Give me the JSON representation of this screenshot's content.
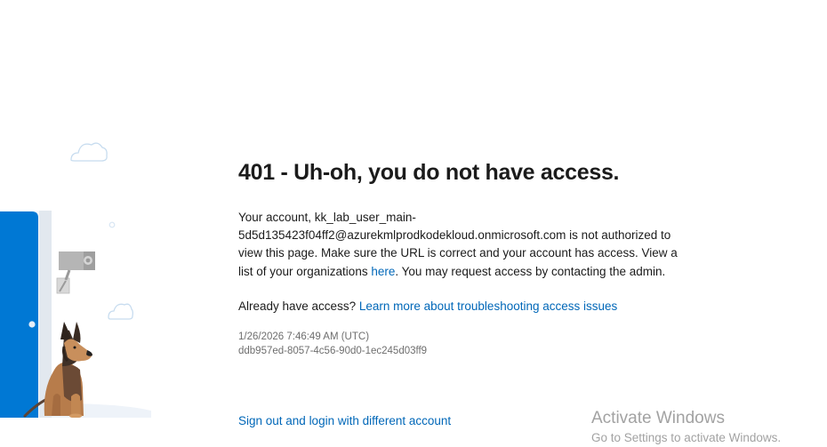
{
  "error": {
    "title": "401 - Uh-oh, you do not have access.",
    "message_part1": "Your account, kk_lab_user_main-5d5d135423f04ff2@azurekmlprodkodekloud.onmicrosoft.com is not authorized to view this page. Make sure the URL is correct and your account has access. View a list of your organizations ",
    "organizations_link": "here",
    "message_part2": ". You may request access by contacting the admin.",
    "already_have_access": "Already have access?",
    "troubleshoot_link": "Learn more about troubleshooting access issues",
    "timestamp": "1/26/2026 7:46:49 AM (UTC)",
    "correlation_id": "ddb957ed-8057-4c56-90d0-1ec245d03ff9",
    "signout_link": "Sign out and login with different account"
  },
  "watermark": {
    "title": "Activate Windows",
    "subtitle": "Go to Settings to activate Windows."
  },
  "colors": {
    "link": "#0067b8",
    "door": "#0078d4",
    "text": "#1b1b1b",
    "muted": "#6e6e6e",
    "watermark": "#a2a2a2"
  },
  "icons": [
    "cloud-icon",
    "security-camera-icon",
    "guard-dog-icon",
    "door-icon"
  ]
}
